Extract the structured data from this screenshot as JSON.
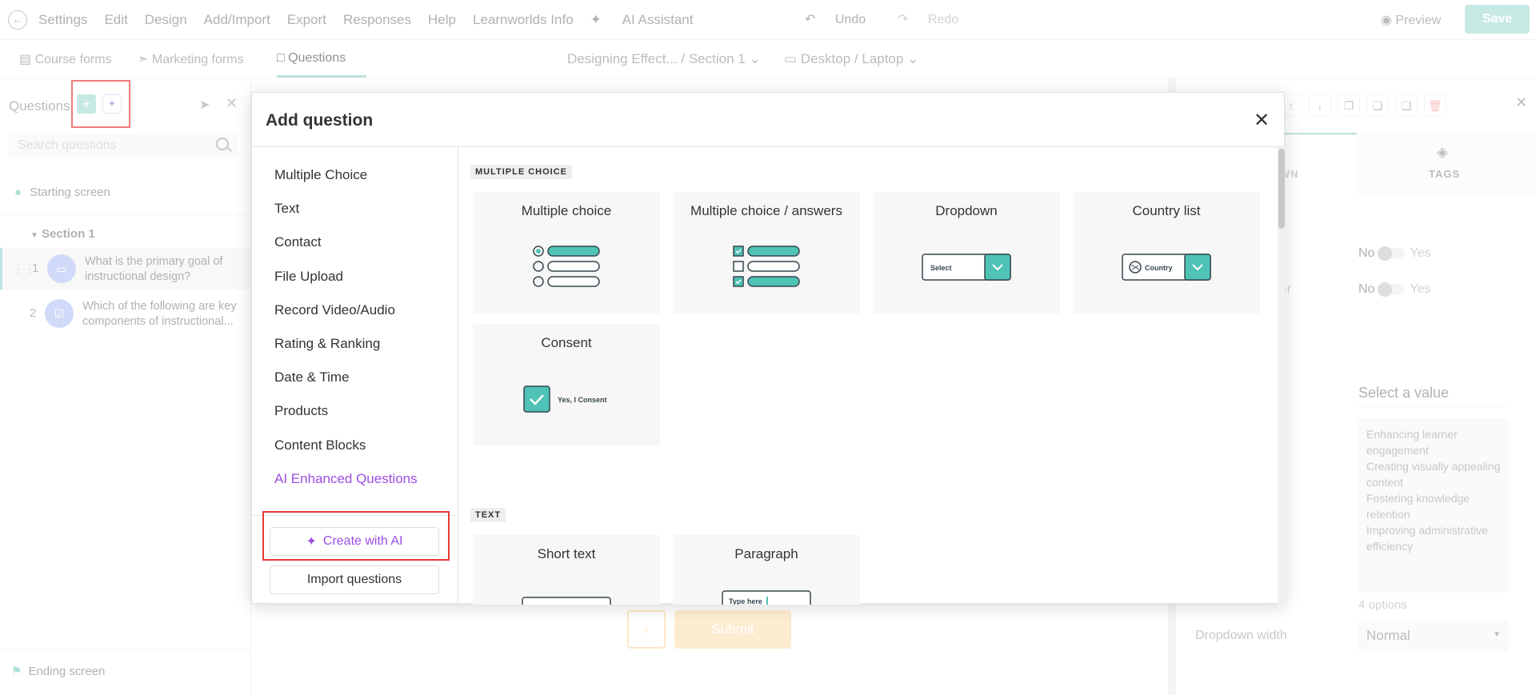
{
  "topbar": {
    "menu": [
      "Settings",
      "Edit",
      "Design",
      "Add/Import",
      "Export",
      "Responses",
      "Help",
      "Learnworlds Info"
    ],
    "ai_assistant": "AI Assistant",
    "undo": "Undo",
    "redo": "Redo",
    "preview": "Preview",
    "save": "Save"
  },
  "subbar": {
    "tabs": [
      "Course forms",
      "Marketing forms",
      "Questions"
    ],
    "active_tab": "Questions",
    "breadcrumb": "Designing Effect... / Section 1",
    "device": "Desktop / Laptop"
  },
  "left_panel": {
    "title": "Questions",
    "search_placeholder": "Search questions",
    "starting_screen": "Starting screen",
    "section": "Section 1",
    "questions": [
      {
        "num": "1",
        "text": "What is the primary goal of instructional design?"
      },
      {
        "num": "2",
        "text": "Which of the following are key components of instructional..."
      }
    ],
    "ending_screen": "Ending screen"
  },
  "canvas": {
    "submit": "Submit"
  },
  "right_panel": {
    "tab_partial": "WN",
    "tab_tags": "TAGS",
    "partial_label": "er",
    "toggle_no": "No",
    "toggle_yes": "Yes",
    "select_value": "Select a value",
    "options": [
      "Enhancing learner engagement",
      "Creating visually appealing content",
      "Fostering knowledge retention",
      "Improving administrative efficiency"
    ],
    "options_count": "4 options",
    "dropdown_width_label": "Dropdown width",
    "dropdown_width_value": "Normal"
  },
  "modal": {
    "title": "Add question",
    "categories": [
      "Multiple Choice",
      "Text",
      "Contact",
      "File Upload",
      "Record Video/Audio",
      "Rating & Ranking",
      "Date & Time",
      "Products",
      "Content Blocks"
    ],
    "ai_category": "AI Enhanced Questions",
    "create_ai": "Create with AI",
    "import": "Import questions",
    "sections": [
      {
        "label": "MULTIPLE CHOICE",
        "cards": [
          {
            "title": "Multiple choice",
            "illus": "radio-list"
          },
          {
            "title": "Multiple choice / answers",
            "illus": "checkbox-list"
          },
          {
            "title": "Dropdown",
            "illus": "dropdown",
            "illus_text": "Select"
          },
          {
            "title": "Country list",
            "illus": "country",
            "illus_text": "Country"
          },
          {
            "title": "Consent",
            "illus": "consent",
            "illus_text": "Yes, I Consent"
          }
        ]
      },
      {
        "label": "TEXT",
        "cards": [
          {
            "title": "Short text",
            "illus": "short-text"
          },
          {
            "title": "Paragraph",
            "illus": "paragraph",
            "illus_text": "Type here"
          }
        ]
      }
    ]
  },
  "colors": {
    "teal": "#4fc3b5",
    "purple": "#9b4de0",
    "highlight_red": "#e53935"
  }
}
